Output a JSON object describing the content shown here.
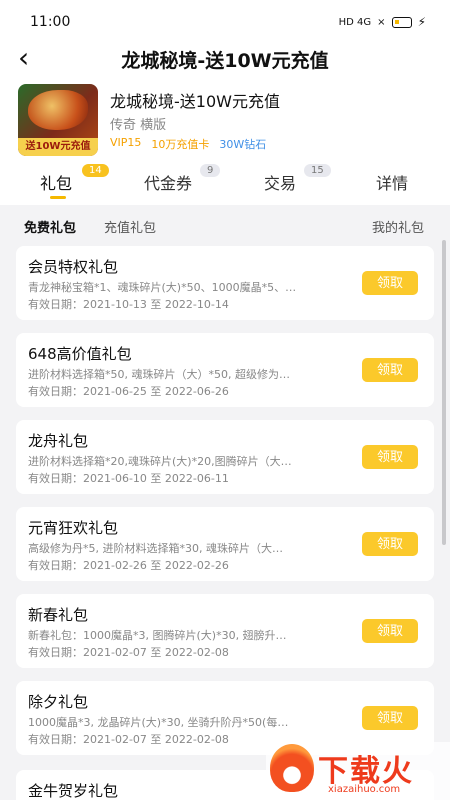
{
  "status_bar": {
    "time": "11:00",
    "network": "HD 4G",
    "signal": "×"
  },
  "header": {
    "title": "龙城秘境-送10W元充值"
  },
  "game": {
    "cover_label": "送10W元充值",
    "name": "龙城秘境-送10W元充值",
    "meta": "传奇  横版",
    "tags": [
      {
        "text": "VIP15",
        "color": "#f5a100"
      },
      {
        "text": "10万充值卡",
        "color": "#f5a100"
      },
      {
        "text": "30W钻石",
        "color": "#3f8fe6"
      }
    ]
  },
  "tabs": [
    {
      "label": "礼包",
      "badge": "14",
      "active": true
    },
    {
      "label": "代金券",
      "badge": "9",
      "active": false
    },
    {
      "label": "交易",
      "badge": "15",
      "active": false
    },
    {
      "label": "详情",
      "badge": "",
      "active": false
    }
  ],
  "subtabs": {
    "free": "免费礼包",
    "recharge": "充值礼包",
    "mine": "我的礼包"
  },
  "claim_label": "领取",
  "gifts": [
    {
      "title": "会员特权礼包",
      "desc": "青龙神秘宝箱*1、魂珠碎片(大)*50、1000魔晶*5、…",
      "date": "有效日期：2021-10-13 至 2022-10-14"
    },
    {
      "title": "648高价值礼包",
      "desc": "进阶材料选择箱*50, 魂珠碎片（大）*50, 超级修为…",
      "date": "有效日期：2021-06-25 至 2022-06-26"
    },
    {
      "title": "龙舟礼包",
      "desc": "进阶材料选择箱*20,魂珠碎片(大)*20,图腾碎片（大…",
      "date": "有效日期：2021-06-10 至 2022-06-11"
    },
    {
      "title": "元宵狂欢礼包",
      "desc": "高级修为丹*5, 进阶材料选择箱*30, 魂珠碎片（大…",
      "date": "有效日期：2021-02-26 至 2022-02-26"
    },
    {
      "title": "新春礼包",
      "desc": "新春礼包：1000魔晶*3, 图腾碎片(大)*30, 翅膀升…",
      "date": "有效日期：2021-02-07 至 2022-02-08"
    },
    {
      "title": "除夕礼包",
      "desc": "1000魔晶*3, 龙晶碎片(大)*30, 坐骑升阶丹*50(每…",
      "date": "有效日期：2021-02-07 至 2022-02-08"
    }
  ],
  "last_gift_title": "金牛贺岁礼包",
  "watermark": {
    "text": "下载火",
    "url": "xiazaihuo.com"
  }
}
